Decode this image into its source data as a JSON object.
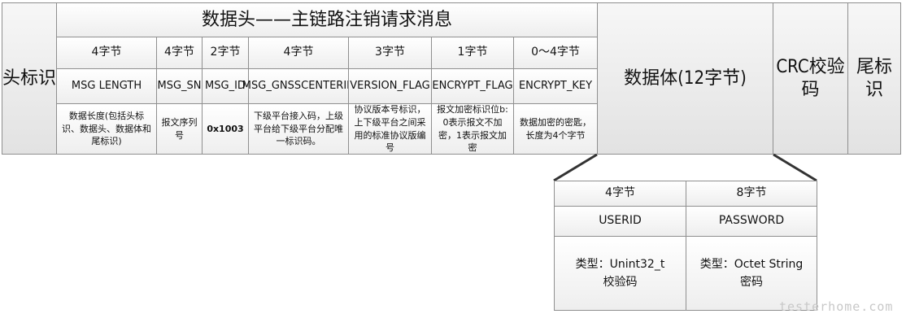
{
  "head_marker": "头标识",
  "header": {
    "title": "数据头——主链路注销请求消息",
    "fields": [
      {
        "bytes": "4字节",
        "name": "MSG LENGTH",
        "desc": "数据长度(包括头标识、数据头、数据体和尾标识)"
      },
      {
        "bytes": "4字节",
        "name": "MSG_SN",
        "desc": "报文序列号"
      },
      {
        "bytes": "2字节",
        "name": "MSG_ID",
        "desc": "0x1003"
      },
      {
        "bytes": "4字节",
        "name": "MSG_GNSSCENTERID",
        "desc": "下级平台接入码，上级平台给下级平台分配唯一标识码。"
      },
      {
        "bytes": "3字节",
        "name": "VERSION_FLAG",
        "desc": "协议版本号标识，上下级平台之间采用的标准协议版编号"
      },
      {
        "bytes": "1字节",
        "name": "ENCRYPT_FLAG",
        "desc": "报文加密标识位b: 0表示报文不加密，1表示报文加密"
      },
      {
        "bytes": "0～4字节",
        "name": "ENCRYPT_KEY",
        "desc": "数据加密的密匙，长度为4个字节"
      }
    ]
  },
  "body_block": "数据体(12字节)",
  "crc_block": "CRC校验码",
  "tail_marker": "尾标识",
  "body_fields": [
    {
      "bytes": "4字节",
      "name": "USERID",
      "type": "类型：Unint32_t",
      "meaning": "校验码"
    },
    {
      "bytes": "8字节",
      "name": "PASSWORD",
      "type": "类型：Octet String",
      "meaning": "密码"
    }
  ],
  "watermark": "testerhome.com"
}
